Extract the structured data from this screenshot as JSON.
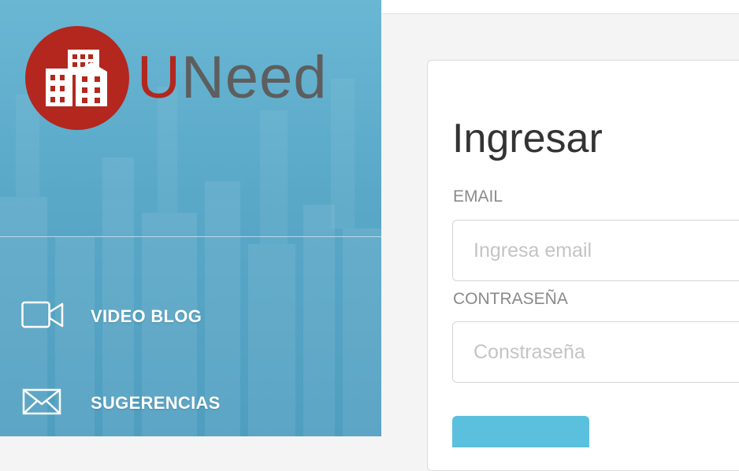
{
  "brand": {
    "name_first": "U",
    "name_rest": "Need",
    "color_primary": "#b3271f",
    "color_text": "#5e5e5e"
  },
  "sidebar": {
    "background": "#5aa8c8",
    "items": [
      {
        "label": "VIDEO BLOG",
        "icon": "video-camera-icon"
      },
      {
        "label": "SUGERENCIAS",
        "icon": "envelope-icon"
      }
    ]
  },
  "login": {
    "title": "Ingresar",
    "email_label": "EMAIL",
    "email_placeholder": "Ingresa email",
    "password_label": "CONTRASEÑA",
    "password_placeholder": "Constraseña",
    "submit_label": "",
    "submit_color": "#5bc0de"
  }
}
